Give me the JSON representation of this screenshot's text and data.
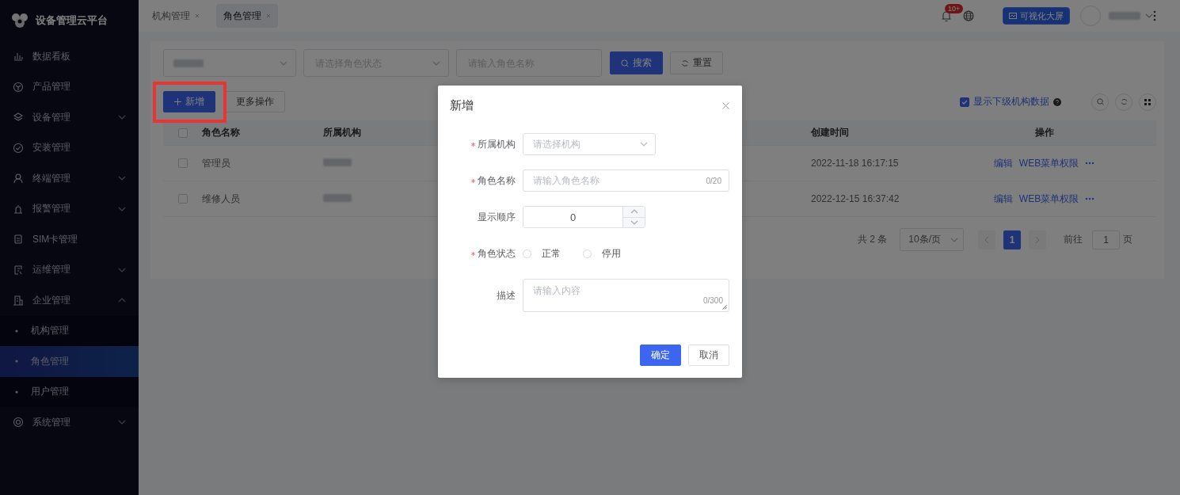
{
  "sidebar": {
    "title": "设备管理云平台",
    "items": [
      {
        "label": "数据看板",
        "kind": "link",
        "selected": false
      },
      {
        "label": "产品管理",
        "kind": "link",
        "selected": false
      },
      {
        "label": "设备管理",
        "kind": "group",
        "expanded": false,
        "selected": false
      },
      {
        "label": "安装管理",
        "kind": "link",
        "selected": false
      },
      {
        "label": "终端管理",
        "kind": "group",
        "expanded": false,
        "selected": false
      },
      {
        "label": "报警管理",
        "kind": "group",
        "expanded": false,
        "selected": false
      },
      {
        "label": "SIM卡管理",
        "kind": "link",
        "selected": false
      },
      {
        "label": "运维管理",
        "kind": "group",
        "expanded": false,
        "selected": false
      },
      {
        "label": "企业管理",
        "kind": "group",
        "expanded": true,
        "selected": false,
        "children": [
          {
            "label": "机构管理",
            "selected": false
          },
          {
            "label": "角色管理",
            "selected": true
          },
          {
            "label": "用户管理",
            "selected": false
          }
        ]
      },
      {
        "label": "系统管理",
        "kind": "group",
        "expanded": false,
        "selected": false
      }
    ]
  },
  "header": {
    "tabs": [
      {
        "label": "机构管理",
        "selected": false
      },
      {
        "label": "角色管理",
        "selected": true
      }
    ],
    "notification_badge": "10+",
    "visualize_button": "可视化大屏",
    "user": {
      "redacted": true
    }
  },
  "filters": {
    "fields": [
      {
        "kind": "select",
        "redacted": true
      },
      {
        "kind": "select",
        "placeholder": "请选择角色状态"
      },
      {
        "kind": "input",
        "placeholder": "请输入角色名称"
      }
    ],
    "buttons": [
      {
        "label": "搜索",
        "kind": "primary"
      },
      {
        "label": "重置",
        "kind": "default"
      }
    ]
  },
  "toolbar": {
    "buttons": [
      {
        "label": "新增",
        "kind": "primary",
        "highlighted": true
      },
      {
        "label": "更多操作",
        "kind": "default",
        "highlighted": false
      }
    ],
    "show_sub_orgs": {
      "label": "显示下级机构数据",
      "checked": true
    }
  },
  "table": {
    "select_all": {
      "checked": false
    },
    "columns": [
      "角色名称",
      "所属机构",
      "创建时间",
      "操作"
    ],
    "rows": [
      {
        "checked": false,
        "name": "管理员",
        "org": {
          "redacted": true
        },
        "created": "2022-11-18 16:17:15",
        "actions": [
          "编辑",
          "WEB菜单权限"
        ]
      },
      {
        "checked": false,
        "name": "维修人员",
        "org": {
          "redacted": true
        },
        "created": "2022-12-15 16:37:42",
        "actions": [
          "编辑",
          "WEB菜单权限"
        ]
      }
    ]
  },
  "pagination": {
    "total": "共 2 条",
    "page_size": "10条/页",
    "pages": [
      {
        "label": "1",
        "selected": true
      }
    ],
    "goto_label": "前往",
    "goto_value": "1",
    "page_suffix": "页"
  },
  "dialog": {
    "title": "新增",
    "fields": [
      {
        "kind": "select",
        "label": "所属机构",
        "required": true,
        "placeholder": "请选择机构"
      },
      {
        "kind": "input",
        "label": "角色名称",
        "required": true,
        "placeholder": "请输入角色名称",
        "counter": "0/20"
      },
      {
        "kind": "number",
        "label": "显示顺序",
        "required": false,
        "value": "0"
      },
      {
        "kind": "radio",
        "label": "角色状态",
        "required": true,
        "options": [
          {
            "label": "正常",
            "selected": false
          },
          {
            "label": "停用",
            "selected": false
          }
        ]
      },
      {
        "kind": "textarea",
        "label": "描述",
        "required": false,
        "placeholder": "请输入内容",
        "counter": "0/300"
      }
    ],
    "buttons": [
      {
        "label": "确定",
        "kind": "primary"
      },
      {
        "label": "取消",
        "kind": "default"
      }
    ]
  }
}
